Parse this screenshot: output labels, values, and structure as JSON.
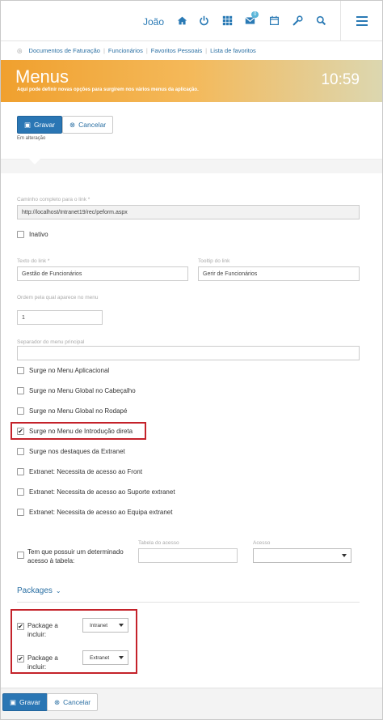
{
  "topbar": {
    "user": "João",
    "badge_count": "0",
    "icons": [
      "home-icon",
      "power-icon",
      "apps-grid-icon",
      "mail-icon",
      "calendar-icon",
      "wrench-icon",
      "search-icon",
      "hamburger-menu-icon"
    ]
  },
  "breadcrumbs": [
    "Documentos de Faturação",
    "Funcionários",
    "Favoritos Pessoais",
    "Lista de favoritos"
  ],
  "header": {
    "title": "Menus",
    "subtitle": "Aqui pode definir novas opções para surgirem nos vários menus da aplicação.",
    "clock": "10:59"
  },
  "actions": {
    "save": "Gravar",
    "cancel": "Cancelar",
    "status": "Em alteração"
  },
  "form": {
    "link_path": {
      "label": "Caminho completo para o link *",
      "value": "http://localhost/Intranet19/rec/peform.aspx"
    },
    "inactive": {
      "label": "Inativo",
      "checked": false
    },
    "link_text": {
      "label": "Texto do link *",
      "value": "Gestão de Funcionários"
    },
    "tooltip": {
      "label": "Tooltip do link",
      "value": "Gerir de Funcionários"
    },
    "order": {
      "label": "Ordem pela qual aparece no menu",
      "value": "1"
    },
    "separator": {
      "label": "Separador do menu principal",
      "value": ""
    },
    "checkboxes": [
      {
        "label": "Surge no Menu Aplicacional",
        "checked": false
      },
      {
        "label": "Surge no Menu Global no Cabeçalho",
        "checked": false
      },
      {
        "label": "Surge no Menu Global no Rodapé",
        "checked": false
      },
      {
        "label": "Surge no Menu de Introdução direta",
        "checked": true
      },
      {
        "label": "Surge nos destaques da Extranet",
        "checked": false
      },
      {
        "label": "Extranet: Necessita de acesso ao Front",
        "checked": false
      },
      {
        "label": "Extranet: Necessita de acesso ao Suporte extranet",
        "checked": false
      },
      {
        "label": "Extranet: Necessita de acesso ao Equipa extranet",
        "checked": false
      }
    ],
    "access": {
      "label": "Tem que possuir um determinado acesso à tabela:",
      "checked": false,
      "table_label": "Tabela do acesso",
      "table_value": "",
      "access_label": "Acesso",
      "access_value": ""
    }
  },
  "packages": {
    "title": "Packages",
    "items": [
      {
        "label": "Package a incluir:",
        "checked": true,
        "value": "Intranet"
      },
      {
        "label": "Package a incluir:",
        "checked": true,
        "value": "Extranet"
      }
    ]
  },
  "footer": {
    "save": "Gravar",
    "cancel": "Cancelar"
  },
  "colors": {
    "accent": "#2a76b4",
    "banner_start": "#f0a02e",
    "highlight": "#c4222a"
  }
}
